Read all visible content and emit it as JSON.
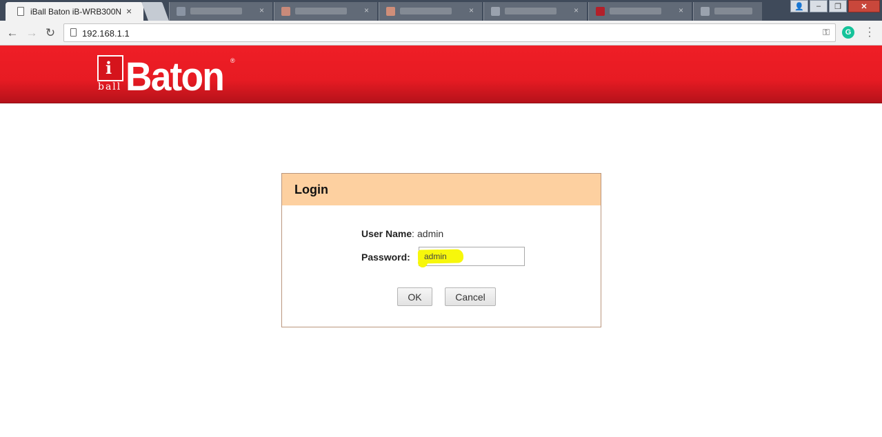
{
  "browser": {
    "active_tab_title": "iBall Baton iB-WRB300N",
    "tab_close": "×",
    "address": "192.168.1.1",
    "extension_letter": "G",
    "window_controls": {
      "user": "👤",
      "minimize": "–",
      "restore": "❐",
      "close": "✕"
    }
  },
  "header": {
    "logo_i": "i",
    "logo_ball": "ball",
    "logo_brand": "Baton",
    "logo_reg": "®"
  },
  "login": {
    "title": "Login",
    "username_label": "User Name",
    "username_sep": ":",
    "username_value": "admin",
    "password_label": "Password:",
    "password_value": "admin",
    "ok_label": "OK",
    "cancel_label": "Cancel"
  },
  "colors": {
    "header_red": "#ef1e26",
    "panel_header": "#fdd0a0",
    "highlight": "#f7f70b"
  }
}
